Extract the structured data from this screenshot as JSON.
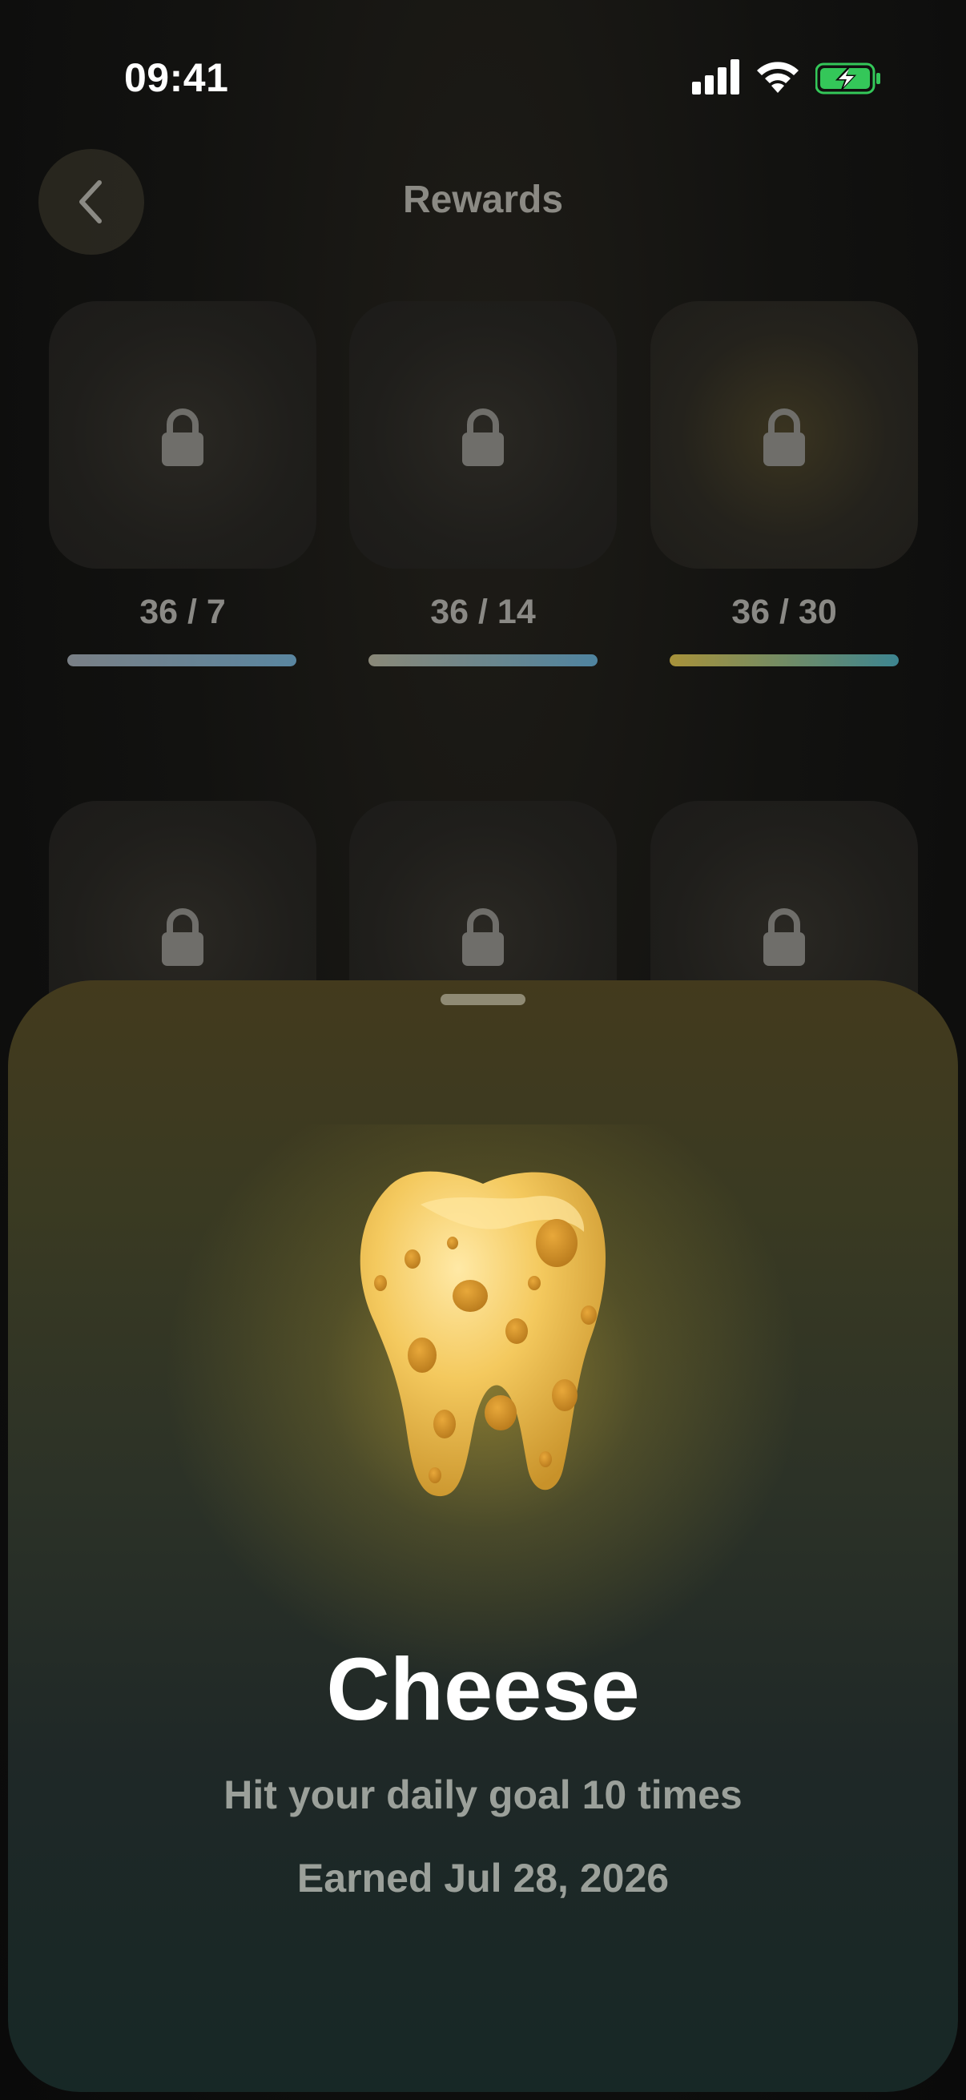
{
  "status_bar": {
    "time": "09:41"
  },
  "nav": {
    "title": "Rewards"
  },
  "rewards_row1": [
    {
      "progress": "36 / 7",
      "bar_colors": [
        "#7a8086",
        "#5a86a0"
      ]
    },
    {
      "progress": "36 / 14",
      "bar_colors": [
        "#8a8878",
        "#4f84a0"
      ]
    },
    {
      "progress": "36 / 30",
      "bar_colors": [
        "#a8923a",
        "#3d8590"
      ]
    }
  ],
  "sheet": {
    "title": "Cheese",
    "description": "Hit your daily goal 10 times",
    "earned": "Earned Jul 28, 2026"
  },
  "colors": {
    "battery_green": "#34c759",
    "sheet_top": "#433a1d",
    "sheet_bottom": "#172826"
  }
}
